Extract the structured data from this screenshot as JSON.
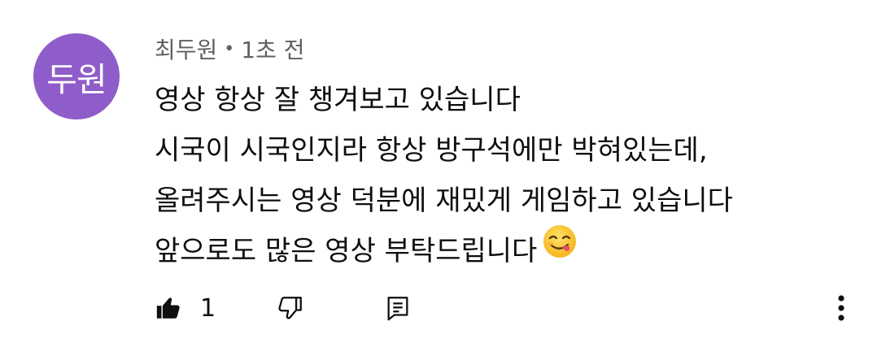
{
  "comment": {
    "avatar_text": "두원",
    "author": "최두원",
    "separator": "•",
    "time": "1초 전",
    "lines": [
      "영상 항상 잘 챙겨보고 있습니다",
      "시국이 시국인지라 항상 방구석에만 박혀있는데,",
      "올려주시는 영상 덕분에 재밌게 게임하고 있습니다",
      "앞으로도 많은 영상 부탁드립니다"
    ],
    "emoji_name": "face-savoring-food-emoji"
  },
  "actions": {
    "like_count": "1",
    "like_icon": "thumbs-up-filled-icon",
    "dislike_icon": "thumbs-down-outline-icon",
    "reply_icon": "reply-comment-icon",
    "more_icon": "more-vert-icon"
  },
  "colors": {
    "avatar_bg": "#8f5dc9",
    "meta_text": "#606060",
    "body_text": "#0f0f0f"
  }
}
